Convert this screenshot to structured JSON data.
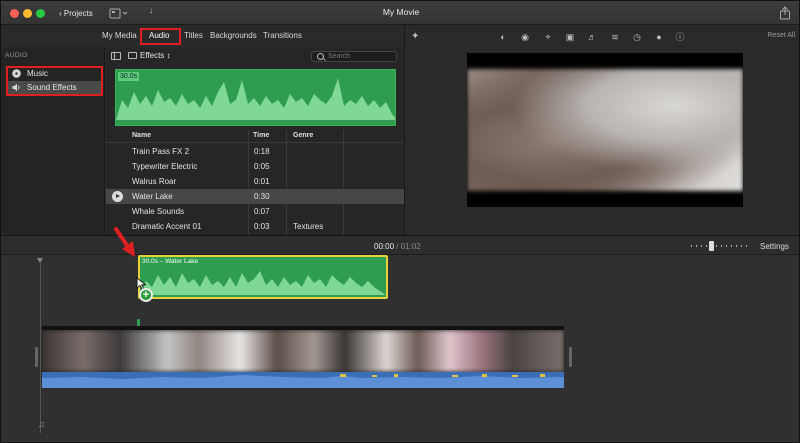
{
  "titlebar": {
    "back_label": "Projects",
    "window_title": "My Movie"
  },
  "tabs": [
    "My Media",
    "Audio",
    "Titles",
    "Backgrounds",
    "Transitions"
  ],
  "active_tab": "Audio",
  "sidebar": {
    "header": "AUDIO",
    "items": [
      {
        "label": "Music",
        "icon": "music-icon"
      },
      {
        "label": "Sound Effects",
        "icon": "speaker-icon"
      }
    ],
    "selected": "Sound Effects"
  },
  "browser": {
    "category": "Effects ↕",
    "search_placeholder": "Search",
    "preview_length": "30.0s",
    "columns": [
      "Name",
      "Time",
      "Genre"
    ],
    "rows": [
      {
        "name": "Train Pass FX 2",
        "time": "0:18",
        "genre": ""
      },
      {
        "name": "Typewriter Electric",
        "time": "0:05",
        "genre": ""
      },
      {
        "name": "Walrus Roar",
        "time": "0:01",
        "genre": ""
      },
      {
        "name": "Water Lake",
        "time": "0:30",
        "genre": ""
      },
      {
        "name": "Whale Sounds",
        "time": "0:07",
        "genre": ""
      },
      {
        "name": "Dramatic Accent 01",
        "time": "0:03",
        "genre": "Textures"
      }
    ],
    "selected_row": "Water Lake"
  },
  "viewer": {
    "reset_label": "Reset All",
    "tools": [
      "color-balance-icon",
      "color-correction-icon",
      "crop-icon",
      "stabilization-icon",
      "volume-icon",
      "noise-reduction-icon",
      "speed-icon",
      "clip-filter-icon",
      "info-icon"
    ]
  },
  "timeline": {
    "current_time": "00:00",
    "separator": "/",
    "total_time": "01:02",
    "settings_label": "Settings",
    "audio_clip_label": "30.0s – Water Lake",
    "add_badge": "+"
  },
  "colors": {
    "highlight": "#e02020",
    "audio_green": "#2f9d4f",
    "clip_selected_border": "#e7d23a",
    "video_audio_blue": "#3a6fb8"
  }
}
